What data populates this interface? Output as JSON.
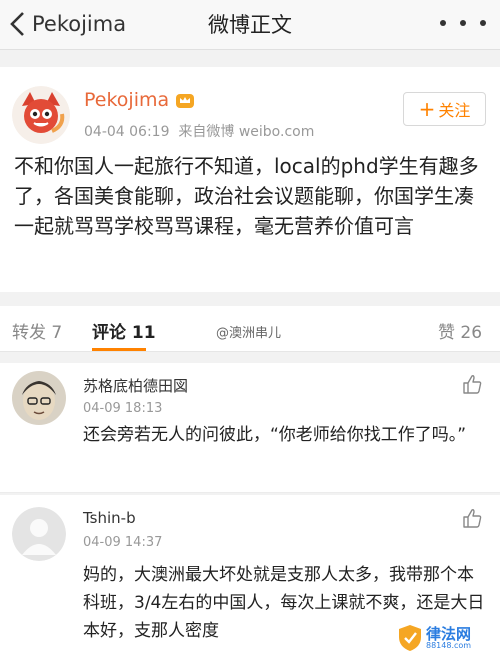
{
  "nav": {
    "back_label": "Pekojima",
    "title": "微博正文"
  },
  "post": {
    "author": "Pekojima",
    "time": "04-04 06:19",
    "source": "来自微博 weibo.com",
    "follow_label": "关注",
    "follow_plus": "+",
    "content": "不和你国人一起旅行不知道，local的phd学生有趣多了，各国美食能聊，政治社会议题能聊，你国学生凑一起就骂骂学校骂骂课程，毫无营养价值可言"
  },
  "tabs": {
    "repost": "转发 7",
    "comment": "评论 11",
    "like": "赞 26",
    "watermark": "@澳洲串儿"
  },
  "comments": [
    {
      "name": "苏格底柏德田図",
      "time": "04-09 18:13",
      "text": "还会旁若无人的问彼此，“你老师给你找工作了吗。”"
    },
    {
      "name": "Tshin-b",
      "time": "04-09 14:37",
      "text": "妈的，大澳洲最大坏处就是支那人太多，我带那个本科班，3/4左右的中国人，每次上课就不爽，还是大日本好，支那人密度"
    }
  ],
  "site_logo": {
    "name": "律法网",
    "url": "88148.com"
  },
  "colors": {
    "accent": "#ff8200",
    "author": "#e8693a"
  }
}
